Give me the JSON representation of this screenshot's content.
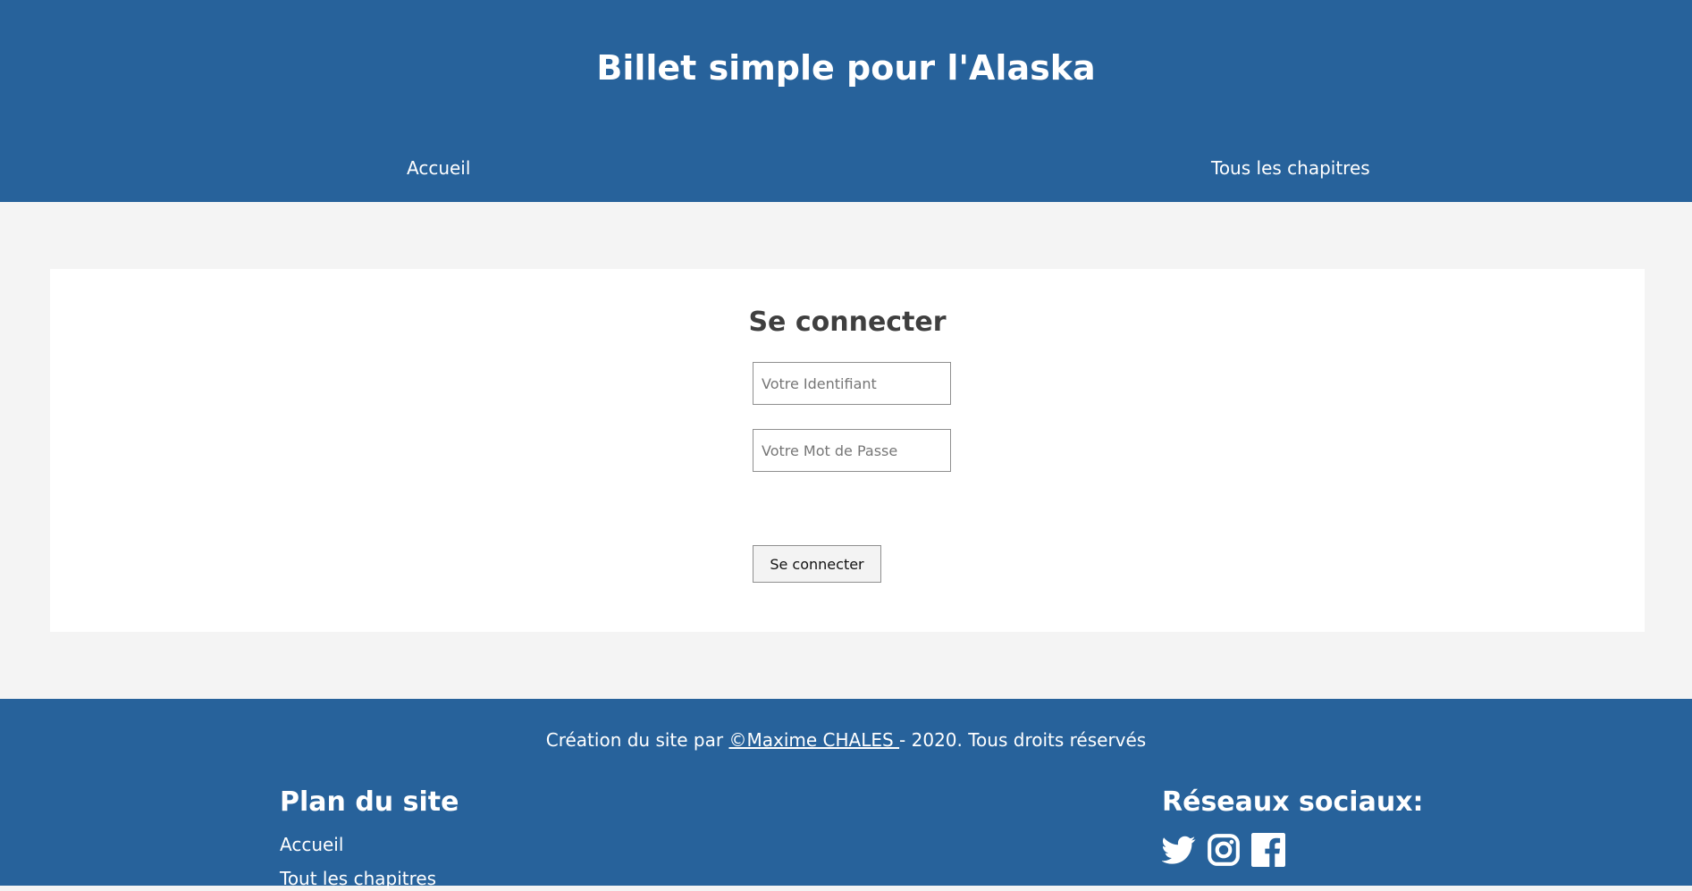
{
  "header": {
    "site_title": "Billet simple pour l'Alaska",
    "nav": {
      "home": "Accueil",
      "chapters": "Tous les chapitres"
    }
  },
  "login": {
    "title": "Se connecter",
    "username_placeholder": "Votre Identifiant",
    "username_value": "",
    "password_placeholder": "Votre Mot de Passe",
    "password_value": "",
    "submit_label": "Se connecter"
  },
  "footer": {
    "credit_before": "Création du site par ",
    "credit_author": "©Maxime CHALES ",
    "credit_after": "- 2020. Tous droits réservés",
    "sitemap_title": "Plan du site",
    "sitemap_links": {
      "home": "Accueil",
      "chapters": "Tout les chapitres"
    },
    "social_title": "Réseaux sociaux:",
    "social_icons": [
      "twitter-icon",
      "instagram-icon",
      "facebook-icon"
    ]
  },
  "colors": {
    "primary": "#27629b",
    "background": "#f4f4f4",
    "card": "#ffffff",
    "heading": "#3f3f3f"
  }
}
